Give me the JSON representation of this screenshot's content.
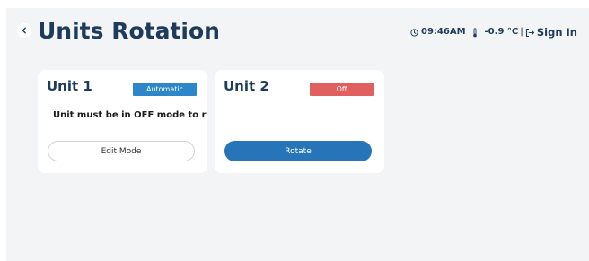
{
  "header": {
    "title": "Units Rotation",
    "back_icon": "chevron-left-icon"
  },
  "status": {
    "time": "09:46AM",
    "temperature": "-0.9 °C",
    "separator": "|",
    "sign_in_label": "Sign In"
  },
  "units": [
    {
      "name": "Unit 1",
      "mode_badge": "Automatic",
      "note": "Unit must be in OFF mode to rotate",
      "action_label": "Edit Mode"
    },
    {
      "name": "Unit 2",
      "mode_badge": "Off",
      "action_label": "Rotate"
    }
  ],
  "colors": {
    "title": "#1f3b5c",
    "background": "#f2f4f6",
    "badge_automatic": "#2c86c9",
    "badge_off": "#e06060",
    "primary_button": "#2874b8"
  }
}
